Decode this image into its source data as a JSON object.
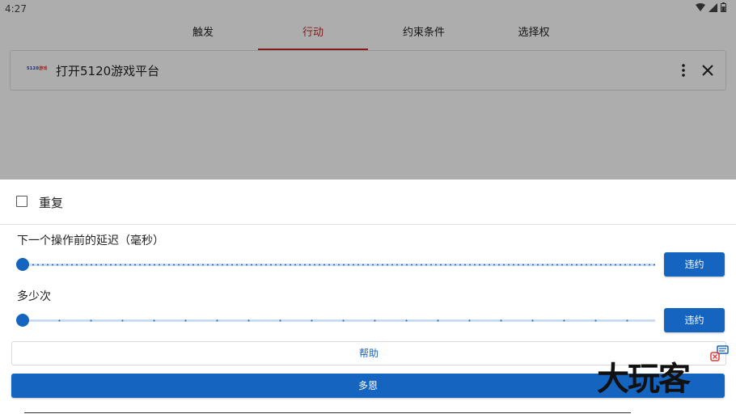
{
  "status_bar": {
    "time": "4:27"
  },
  "tabs": [
    {
      "label": "触发",
      "active": false
    },
    {
      "label": "行动",
      "active": true
    },
    {
      "label": "约束条件",
      "active": false
    },
    {
      "label": "选择权",
      "active": false
    }
  ],
  "action": {
    "logo_text_blue": "5120",
    "logo_text_red": "游戏",
    "title": "打开5120游戏平台"
  },
  "sheet": {
    "repeat_label": "重复",
    "repeat_checked": false,
    "delay": {
      "label": "下一个操作前的延迟（毫秒）",
      "value": 0,
      "button_label": "违约"
    },
    "count": {
      "label": "多少次",
      "value": 0,
      "button_label": "违约"
    },
    "help_label": "帮助",
    "done_label": "多恩"
  },
  "watermark": "大玩客",
  "colors": {
    "accent": "#1565c0",
    "active_tab": "#c62828"
  }
}
